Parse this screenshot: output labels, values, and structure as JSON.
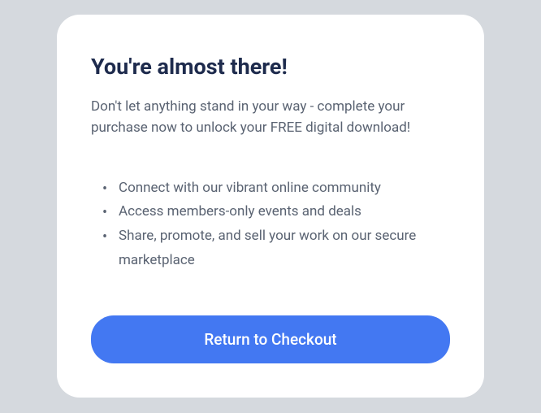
{
  "card": {
    "title": "You're almost there!",
    "subtitle": "Don't let anything stand in your way - complete your purchase now to unlock your FREE digital download!",
    "benefits": [
      "Connect with our vibrant online community",
      "Access members-only events and deals",
      "Share, promote, and sell your work on our secure marketplace"
    ],
    "cta_label": "Return to Checkout"
  }
}
